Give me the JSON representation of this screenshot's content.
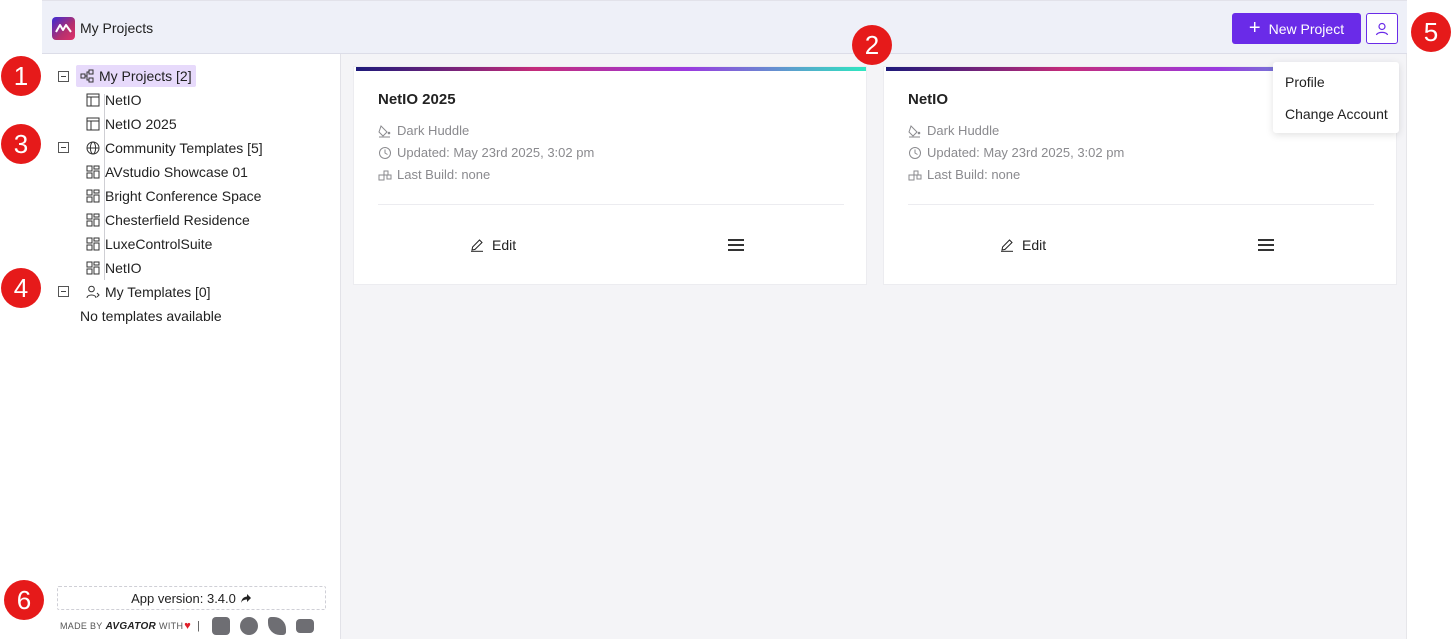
{
  "header": {
    "app_title": "My Projects",
    "new_project_label": "New Project",
    "brand_color": "#6a2be8"
  },
  "account_menu": {
    "items": [
      "Profile",
      "Change Account"
    ]
  },
  "sidebar": {
    "tree": [
      {
        "label": "My Projects [2]",
        "icon": "projects-icon",
        "selected": true,
        "children": [
          "NetIO",
          "NetIO 2025"
        ]
      },
      {
        "label": "Community Templates [5]",
        "icon": "globe-icon",
        "children": [
          "AVstudio Showcase 01",
          "Bright Conference Space",
          "Chesterfield Residence",
          "LuxeControlSuite",
          "NetIO"
        ]
      },
      {
        "label": "My Templates [0]",
        "icon": "user-templates-icon",
        "empty_text": "No templates available"
      }
    ],
    "version_label": "App version: 3.4.0",
    "footer": {
      "made_by": "MADE BY",
      "brand": "AVGATOR",
      "with": "WITH",
      "separator": "|"
    }
  },
  "projects": [
    {
      "name": "NetIO 2025",
      "theme": "Dark Huddle",
      "updated": "Updated: May 23rd 2025, 3:02 pm",
      "last_build": "Last Build: none",
      "edit_label": "Edit"
    },
    {
      "name": "NetIO",
      "theme": "Dark Huddle",
      "updated": "Updated: May 23rd 2025, 3:02 pm",
      "last_build": "Last Build: none",
      "edit_label": "Edit"
    }
  ],
  "annotations": [
    "1",
    "2",
    "3",
    "4",
    "5",
    "6"
  ]
}
